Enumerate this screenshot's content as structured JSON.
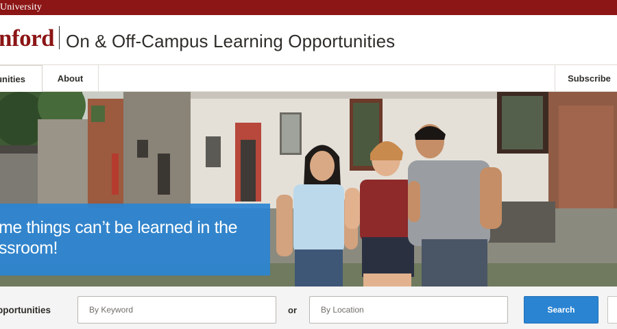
{
  "topbar": {
    "text": "University"
  },
  "header": {
    "logo": "nford",
    "site_title": "On & Off-Campus Learning Opportunities"
  },
  "nav": {
    "items": [
      {
        "label": "unities",
        "active": true
      },
      {
        "label": "About",
        "active": false
      }
    ],
    "subscribe": "Subscribe"
  },
  "hero": {
    "caption": "me things can’t be learned in the ssroom!"
  },
  "search": {
    "label": "pportunities",
    "keyword_placeholder": "By Keyword",
    "or_label": "or",
    "location_placeholder": "By Location",
    "button_label": "Search"
  },
  "colors": {
    "brand": "#8c1515",
    "accent": "#2a84d2"
  }
}
